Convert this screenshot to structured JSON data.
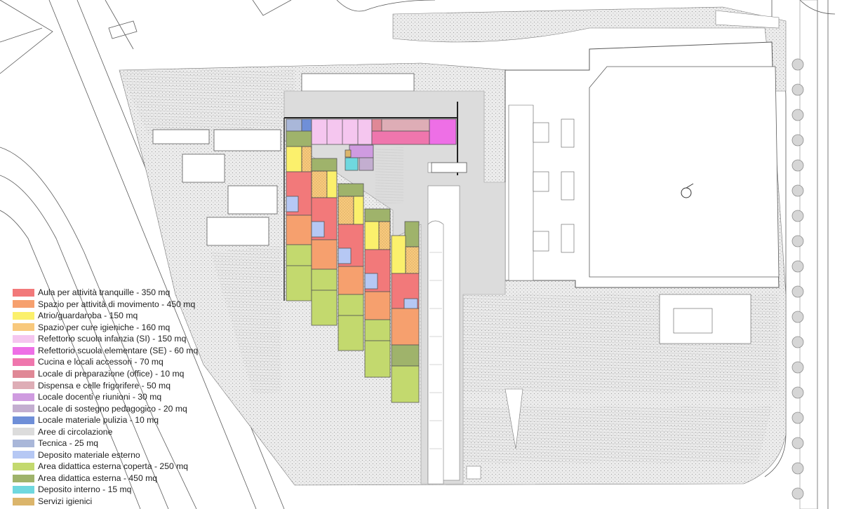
{
  "legend": [
    {
      "label": "Aula per attività tranquille - 350 mq",
      "color": "#f2797a"
    },
    {
      "label": "Spazio per attività di movimento - 450 mq",
      "color": "#f6a06e"
    },
    {
      "label": "Atrio/guardaroba - 150 mq",
      "color": "#fbf06c"
    },
    {
      "label": "Spazio per cure igieniche - 160 mq",
      "color": "#f8c97d"
    },
    {
      "label": "Refettorio scuola infanzia (SI) - 150 mq",
      "color": "#f5c6ef"
    },
    {
      "label": "Refettorio scuola elementare (SE) - 60 mq",
      "color": "#ee6fe6"
    },
    {
      "label": "Cucina e locali accessori - 70 mq",
      "color": "#ef76ad"
    },
    {
      "label": "Locale di preparazione (office) - 10 mq",
      "color": "#e08896"
    },
    {
      "label": "Dispensa e celle frigorifere - 50 mq",
      "color": "#deadb6"
    },
    {
      "label": "Locale docenti e riunioni - 30 mq",
      "color": "#cf9be0"
    },
    {
      "label": "Locale di sostegno pedagogico - 20 mq",
      "color": "#c3aed0"
    },
    {
      "label": "Locale materiale pulizia - 10 mq",
      "color": "#6f8fd8"
    },
    {
      "label": "Aree di circolazione",
      "color": "#dcdcdc"
    },
    {
      "label": "Tecnica - 25 mq",
      "color": "#a9b7d9"
    },
    {
      "label": "Deposito materiale esterno",
      "color": "#b6c8f4"
    },
    {
      "label": "Area didattica esterna coperta - 250 mq",
      "color": "#c3d96e"
    },
    {
      "label": "Area didattica esterna - 450 mq",
      "color": "#9fb36b"
    },
    {
      "label": "Deposito interno - 15 mq",
      "color": "#6fd8df"
    },
    {
      "label": "Servizi igienici",
      "color": "#dbb56b"
    }
  ]
}
